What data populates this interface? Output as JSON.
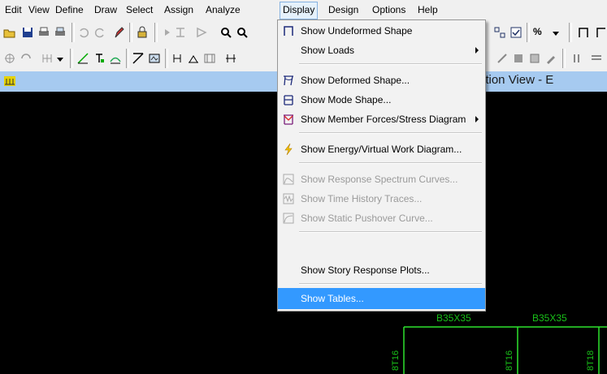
{
  "menubar": {
    "items": [
      "Edit",
      "View",
      "Define",
      "Draw",
      "Select",
      "Assign",
      "Analyze",
      "Display",
      "Design",
      "Options",
      "Help"
    ],
    "active_item": "Display"
  },
  "toolbar": {
    "zoom_label": "%"
  },
  "view_window": {
    "title": "ation View - E"
  },
  "display_menu": {
    "items": [
      {
        "label": "Show Undeformed Shape",
        "icon": "undeformed-shape-icon",
        "enabled": true
      },
      {
        "label": "Show Loads",
        "submenu": true,
        "enabled": true
      },
      {
        "label": "Show Deformed Shape...",
        "icon": "deformed-shape-icon",
        "enabled": true
      },
      {
        "label": "Show Mode Shape...",
        "icon": "mode-shape-icon",
        "enabled": true
      },
      {
        "label": "Show Member Forces/Stress Diagram",
        "icon": "member-forces-icon",
        "submenu": true,
        "enabled": true
      },
      {
        "label": "Show Energy/Virtual Work Diagram...",
        "icon": "energy-lightning-icon",
        "enabled": true
      },
      {
        "label": "Show Response Spectrum Curves...",
        "icon": "response-spectrum-icon",
        "enabled": false
      },
      {
        "label": "Show Time History Traces...",
        "icon": "time-history-icon",
        "enabled": false
      },
      {
        "label": "Show Static Pushover Curve...",
        "icon": "pushover-curve-icon",
        "enabled": false
      },
      {
        "label": "Show Story Response Plots...",
        "enabled": true
      },
      {
        "label": "Show Tables...",
        "enabled": true,
        "highlighted": true
      }
    ],
    "highlight_color": "#3399ff"
  },
  "model_view": {
    "beam_labels": [
      "B35X35",
      "B35X35"
    ],
    "column_labels": [
      "8T16",
      "8T16",
      "8T18"
    ],
    "element_color": "#19c219",
    "background": "#000000"
  }
}
